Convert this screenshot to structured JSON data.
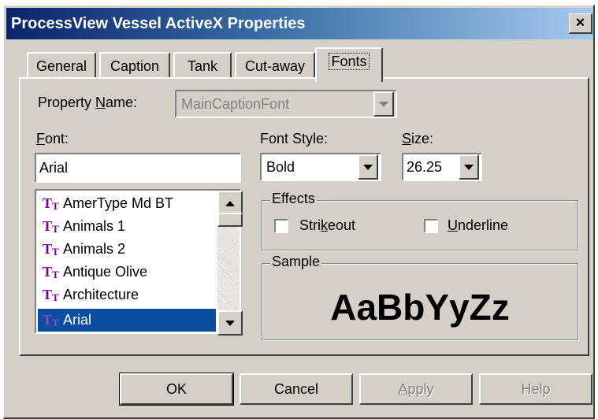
{
  "window": {
    "title": "ProcessView Vessel ActiveX Properties",
    "close_glyph": "×"
  },
  "tabs": [
    {
      "label": "General"
    },
    {
      "label": "Caption"
    },
    {
      "label": "Tank"
    },
    {
      "label": "Cut-away"
    },
    {
      "label": "Fonts",
      "active": true
    }
  ],
  "property_name": {
    "label_pre": "Property ",
    "label_u": "N",
    "label_post": "ame:",
    "value": "MainCaptionFont",
    "disabled": true
  },
  "font": {
    "label_u": "F",
    "label_post": "ont:",
    "value": "Arial",
    "list": [
      {
        "name": "AmerType Md BT"
      },
      {
        "name": "Animals 1"
      },
      {
        "name": "Animals 2"
      },
      {
        "name": "Antique Olive"
      },
      {
        "name": "Architecture"
      },
      {
        "name": "Arial",
        "selected": true
      }
    ],
    "icon": "truetype-icon"
  },
  "font_style": {
    "label": "Font Style:",
    "value": "Bold"
  },
  "size": {
    "label_u": "S",
    "label_post": "ize:",
    "value": "26.25"
  },
  "effects": {
    "label": "Effects",
    "strikeout": {
      "pre": "Stri",
      "u": "k",
      "post": "eout",
      "checked": false
    },
    "underline": {
      "u": "U",
      "post": "nderline",
      "checked": false
    }
  },
  "sample": {
    "label": "Sample",
    "text": "AaBbYyZz"
  },
  "buttons": {
    "ok": "OK",
    "cancel": "Cancel",
    "apply": {
      "u": "A",
      "post": "pply",
      "disabled": true
    },
    "help": {
      "label": "Help",
      "disabled": true
    }
  },
  "colors": {
    "title_start": "#0a246a",
    "title_end": "#a6caf0",
    "face": "#d4d0c8",
    "selection": "#0a4ea0",
    "truetype": "#7a0099"
  }
}
